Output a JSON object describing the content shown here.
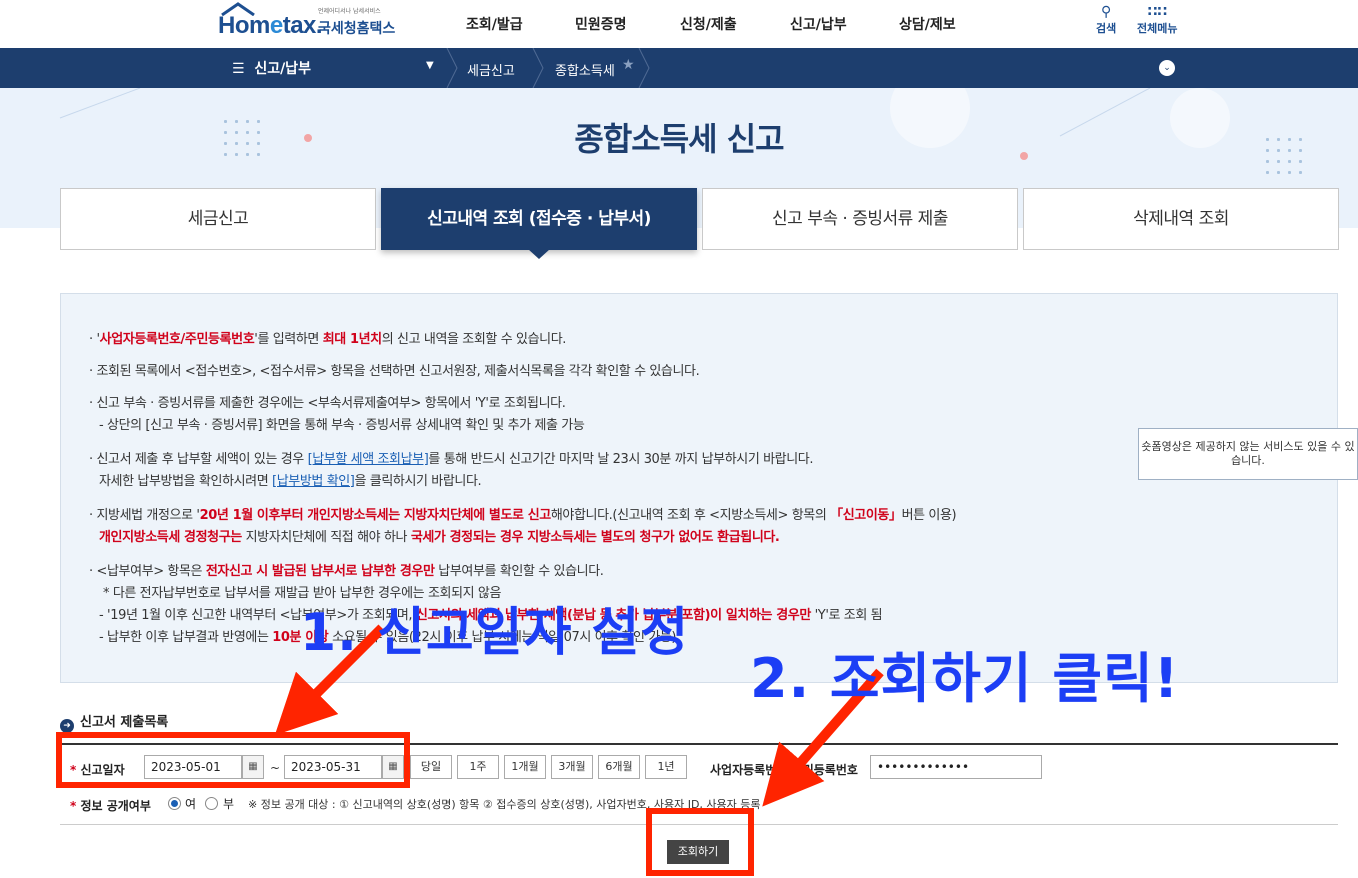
{
  "header": {
    "logo_tag": "언제어디서나 납세서비스",
    "logo_text_home": "Hom",
    "logo_text_e": "e",
    "logo_text_tax": "tax.",
    "logo_sub": "국세청홈택스",
    "menu": [
      "조회/발급",
      "민원증명",
      "신청/제출",
      "신고/납부",
      "상담/제보"
    ],
    "search_label": "검색",
    "allmenu_label": "전체메뉴"
  },
  "navbar": {
    "main_label": "신고/납부",
    "crumbs": [
      "세금신고",
      "종합소득세"
    ]
  },
  "hero": {
    "title": "종합소득세 신고"
  },
  "tabs": [
    "세금신고",
    "신고내역 조회 (접수증 · 납부서)",
    "신고 부속 · 증빙서류 제출",
    "삭제내역 조회"
  ],
  "info": {
    "l1a": "· '",
    "l1b": "사업자등록번호/주민등록번호",
    "l1c": "'를 입력하면 ",
    "l1d": "최대 1년치",
    "l1e": "의 신고 내역을 조회할 수 있습니다.",
    "l2": "· 조회된 목록에서 <접수번호>, <접수서류> 항목을 선택하면 신고서원장, 제출서식목록을 각각 확인할 수 있습니다.",
    "l3": "· 신고 부속 · 증빙서류를 제출한 경우에는 <부속서류제출여부> 항목에서 'Y'로 조회됩니다.",
    "l3b": "- 상단의 [신고 부속 · 증빙서류] 화면을 통해 부속 · 증빙서류 상세내역 확인 및 추가 제출 가능",
    "l4a": "· 신고서 제출 후 납부할 세액이 있는 경우 ",
    "l4b": "[납부할 세액 조회납부]",
    "l4c": "를 통해 반드시 신고기간 마지막 날 23시 30분 까지 납부하시기 바랍니다.",
    "l4d": "자세한 납부방법을 확인하시려면 ",
    "l4e": "[납부방법 확인]",
    "l4f": "을 클릭하시기 바랍니다.",
    "l5a": "· 지방세법 개정으로 '",
    "l5b": "20년 1월 이후부터 개인지방소득세는 지방자치단체에 별도로 신고",
    "l5c": "해야합니다.(신고내역 조회 후 <지방소득세> 항목의 ",
    "l5d": "「신고이동」",
    "l5e": "버튼 이용)",
    "l5f": "개인지방소득세 경정청구는",
    "l5g": " 지방자치단체에 직접 해야 하나 ",
    "l5h": "국세가 경정되는 경우 지방소득세는 별도의 청구가 없어도 환급됩니다.",
    "l6a": "· <납부여부> 항목은 ",
    "l6b": "전자신고 시 발급된 납부서로 납부한 경우만",
    "l6c": " 납부여부를 확인할 수 있습니다.",
    "l6d": "* 다른 전자납부번호로 납부서를 재발급 받아 납부한 경우에는 조회되지 않음",
    "l6e": "- '19년 1월 이후 신고한 내역부터 <납부여부>가 조회되며, ",
    "l6f": "신고서의 세액과 납부한 세액(분납 등 추가 납부분 포함)이 일치하는 경우만",
    "l6g": " 'Y'로 조회 됨",
    "l6h": "- 납부한 이후 납부결과 반영에는 ",
    "l6i": "10분 이상",
    "l6j": " 소요될 수 있음(22시 이후 납부 시에는 익일 07시 이후 확인 가능)"
  },
  "tooltip": "숏폼영상은 제공하지 않는 서비스도 있을 수 있습니다.",
  "section": {
    "title": "신고서 제출목록"
  },
  "form": {
    "date_label": "신고일자",
    "date_from": "2023-05-01",
    "date_to": "2023-05-31",
    "tilde": "~",
    "periods": [
      "당일",
      "1주",
      "1개월",
      "3개월",
      "6개월",
      "1년"
    ],
    "id_label": "사업자등록번호/주민등록번호",
    "id_value": "•••••••••••••",
    "disclosure_label": "정보 공개여부",
    "radio_yes": "여",
    "radio_no": "부",
    "disclosure_note": "※ 정보 공개 대상 : ① 신고내역의 상호(성명) 항목 ② 접수증의 상호(성명), 사업자번호, 사용자 ID, 사용자 등록",
    "search_button": "조회하기"
  },
  "annotations": {
    "step1": "1. 신고일자 설정",
    "step2": "2. 조회하기 클릭!",
    "color": "#1c3ef5",
    "highlight_color": "#ff2400"
  }
}
